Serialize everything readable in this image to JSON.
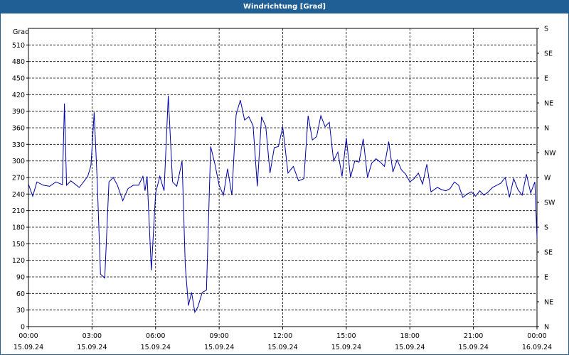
{
  "title": "Windrichtung [Grad]",
  "chart_data": {
    "type": "line",
    "title": "Windrichtung [Grad]",
    "ylabel": "Grad",
    "ylim": [
      0,
      540
    ],
    "yticks": [
      0,
      30,
      60,
      90,
      120,
      150,
      180,
      210,
      240,
      270,
      300,
      330,
      360,
      390,
      420,
      450,
      480,
      510
    ],
    "y2ticks": [
      {
        "value": 0,
        "label": "N"
      },
      {
        "value": 45,
        "label": "NE"
      },
      {
        "value": 90,
        "label": "E"
      },
      {
        "value": 135,
        "label": "SE"
      },
      {
        "value": 180,
        "label": "S"
      },
      {
        "value": 225,
        "label": "SW"
      },
      {
        "value": 270,
        "label": "W"
      },
      {
        "value": 315,
        "label": "NW"
      },
      {
        "value": 360,
        "label": "N"
      },
      {
        "value": 405,
        "label": "NE"
      },
      {
        "value": 450,
        "label": "E"
      },
      {
        "value": 495,
        "label": "SE"
      },
      {
        "value": 540,
        "label": "S"
      }
    ],
    "xlim": [
      "15.09.24 00:00",
      "16.09.24 00:00"
    ],
    "xticks": [
      {
        "time": "00:00",
        "date": "15.09.24"
      },
      {
        "time": "03:00",
        "date": "15.09.24"
      },
      {
        "time": "06:00",
        "date": "15.09.24"
      },
      {
        "time": "09:00",
        "date": "15.09.24"
      },
      {
        "time": "12:00",
        "date": "15.09.24"
      },
      {
        "time": "15:00",
        "date": "15.09.24"
      },
      {
        "time": "18:00",
        "date": "15.09.24"
      },
      {
        "time": "21:00",
        "date": "15.09.24"
      },
      {
        "time": "00:00",
        "date": "16.09.24"
      }
    ],
    "grid": true,
    "line_color": "#0000aa",
    "x_hours": [
      0,
      0.2,
      0.4,
      0.7,
      1.0,
      1.3,
      1.6,
      1.7,
      1.8,
      2.0,
      2.4,
      2.8,
      2.95,
      3.1,
      3.25,
      3.4,
      3.6,
      3.8,
      4.0,
      4.2,
      4.45,
      4.7,
      4.95,
      5.2,
      5.4,
      5.5,
      5.6,
      5.8,
      6.0,
      6.2,
      6.4,
      6.6,
      6.8,
      7.0,
      7.25,
      7.4,
      7.55,
      7.7,
      7.85,
      8.0,
      8.2,
      8.4,
      8.6,
      8.8,
      9.0,
      9.2,
      9.4,
      9.6,
      9.8,
      10.0,
      10.2,
      10.4,
      10.6,
      10.8,
      11.0,
      11.2,
      11.4,
      11.6,
      11.8,
      12.0,
      12.25,
      12.5,
      12.75,
      13.0,
      13.2,
      13.4,
      13.6,
      13.8,
      14.0,
      14.2,
      14.4,
      14.6,
      14.8,
      15.0,
      15.2,
      15.4,
      15.6,
      15.8,
      16.0,
      16.2,
      16.4,
      16.6,
      16.8,
      17.0,
      17.2,
      17.4,
      17.6,
      17.8,
      18.0,
      18.2,
      18.4,
      18.6,
      18.8,
      19.0,
      19.3,
      19.5,
      19.7,
      19.9,
      20.1,
      20.3,
      20.5,
      20.7,
      20.9,
      21.1,
      21.3,
      21.5,
      21.7,
      21.9,
      22.1,
      22.3,
      22.5,
      22.7,
      22.9,
      23.1,
      23.3,
      23.5,
      23.7,
      23.9,
      24.0
    ],
    "values": [
      258,
      236,
      262,
      256,
      254,
      262,
      257,
      404,
      256,
      264,
      252,
      272,
      292,
      388,
      260,
      95,
      88,
      262,
      270,
      256,
      228,
      250,
      256,
      256,
      272,
      246,
      272,
      102,
      242,
      272,
      246,
      418,
      262,
      254,
      300,
      110,
      38,
      62,
      26,
      36,
      62,
      66,
      326,
      294,
      256,
      238,
      286,
      238,
      384,
      410,
      374,
      380,
      364,
      254,
      380,
      362,
      278,
      324,
      326,
      362,
      278,
      290,
      264,
      268,
      382,
      338,
      344,
      382,
      362,
      370,
      300,
      316,
      272,
      342,
      270,
      300,
      298,
      340,
      270,
      296,
      304,
      298,
      290,
      335,
      280,
      302,
      284,
      276,
      262,
      268,
      278,
      258,
      294,
      244,
      252,
      248,
      246,
      250,
      262,
      256,
      234,
      240,
      244,
      236,
      246,
      238,
      244,
      252,
      256,
      260,
      270,
      234,
      268,
      248,
      238,
      276,
      242,
      262,
      162
    ]
  }
}
